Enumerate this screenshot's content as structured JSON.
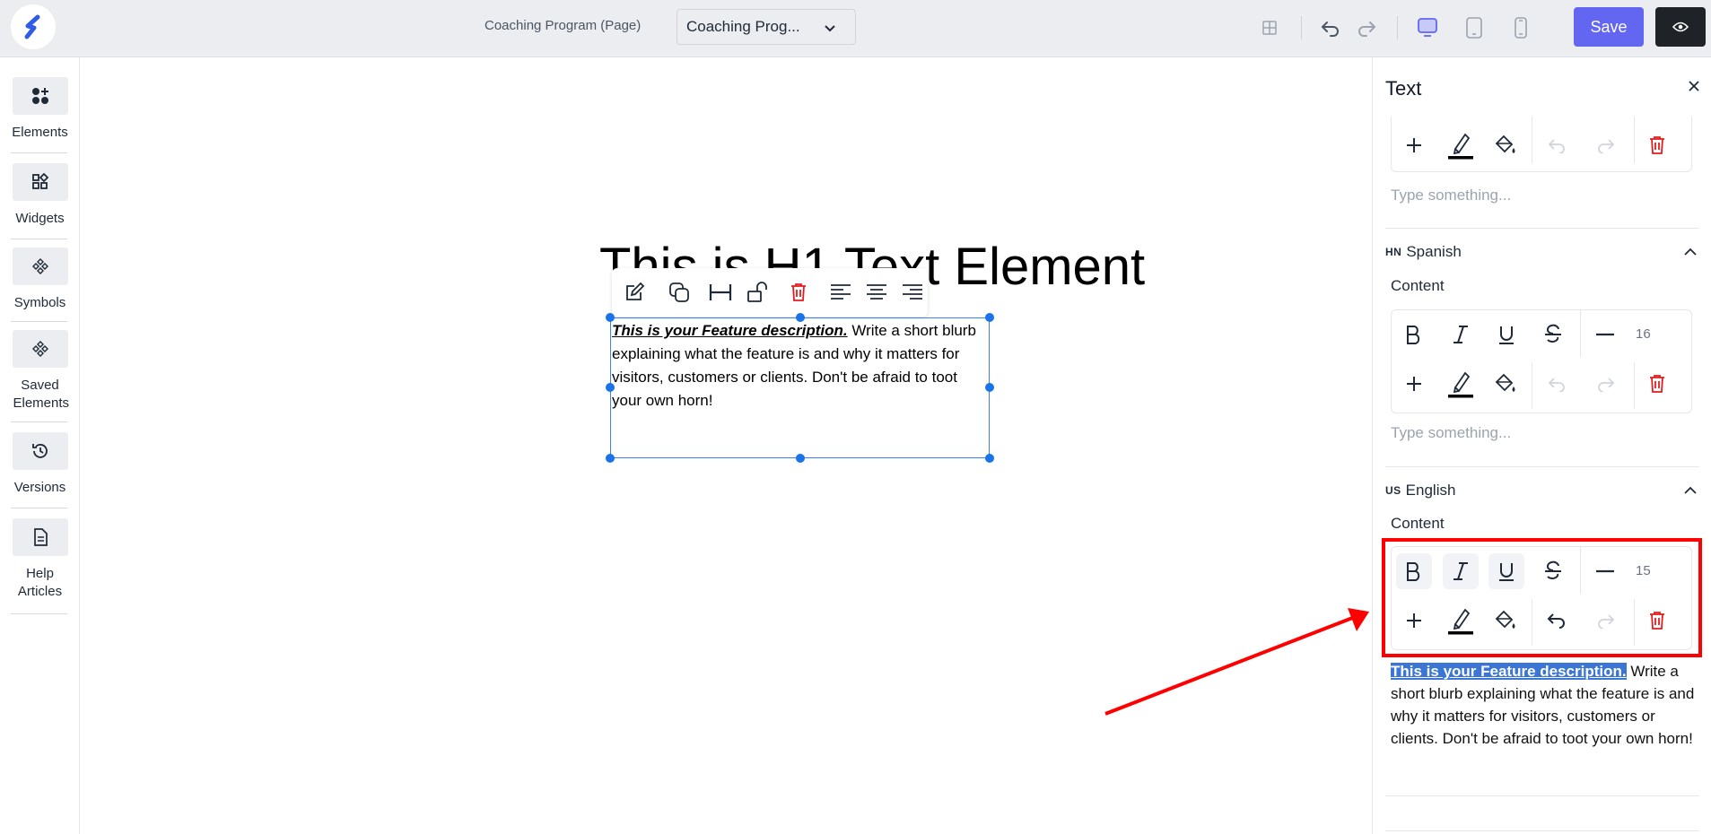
{
  "topbar": {
    "page_name": "Coaching Program (Page)",
    "page_select_value": "Coaching Prog...",
    "save_label": "Save"
  },
  "sidebar": {
    "items": [
      {
        "label": "Elements",
        "icon": "elements-icon"
      },
      {
        "label": "Widgets",
        "icon": "widgets-icon"
      },
      {
        "label": "Symbols",
        "icon": "symbols-icon"
      },
      {
        "label": "Saved Elements",
        "icon": "saved-elements-icon"
      },
      {
        "label": "Versions",
        "icon": "history-icon"
      },
      {
        "label": "Help Articles",
        "icon": "document-icon"
      }
    ]
  },
  "canvas": {
    "heading": "This is H1 Text Element",
    "feature_lead": "This is your Feature description.",
    "feature_body": " Write a short blurb explaining what the feature is and why it matters for visitors, customers or clients. Don't be afraid to toot your own horn!"
  },
  "panel": {
    "title": "Text",
    "placeholder": "Type something...",
    "content_label": "Content",
    "spanish": {
      "code": "HN",
      "name": "Spanish",
      "font_size": "16"
    },
    "english": {
      "code": "US",
      "name": "English",
      "font_size": "15"
    },
    "english_text_lead": "This is your Feature description.",
    "english_text_body": " Write a short blurb explaining what the feature is and why it matters for visitors, customers or clients. Don't be afraid to toot your own horn!"
  },
  "colors": {
    "accent": "#6366f1",
    "selection": "#3b82f6",
    "delete": "#e11d1d",
    "annotation": "#ff0000"
  }
}
